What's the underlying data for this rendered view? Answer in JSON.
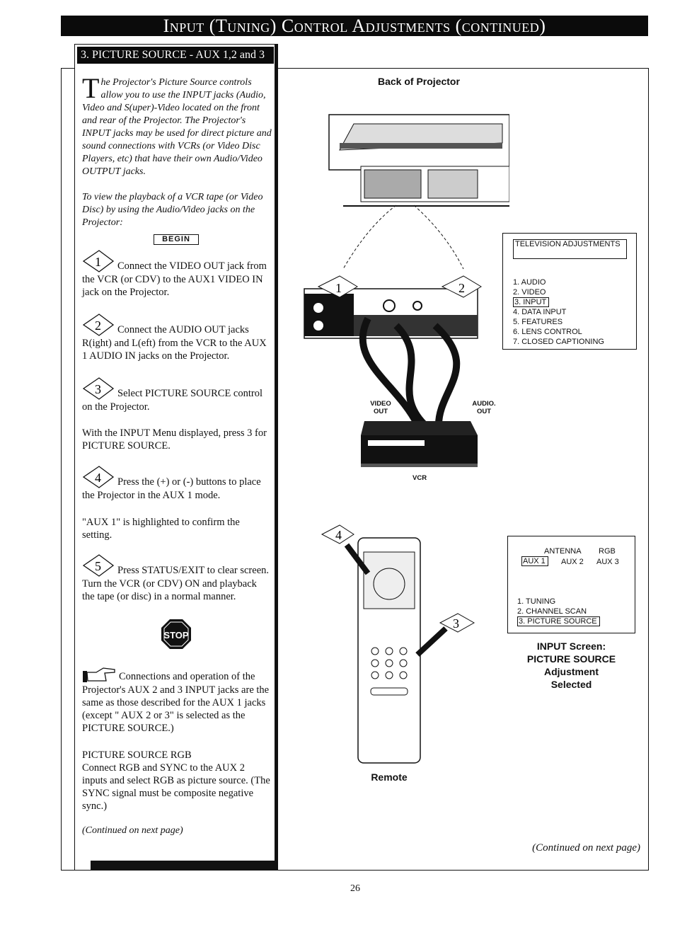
{
  "header": {
    "title": "Input (Tuning) Control Adjustments (continued)"
  },
  "section": {
    "title": "3. PICTURE SOURCE - AUX 1,2 and 3"
  },
  "intro": {
    "drop_cap": "T",
    "text": "he Projector's Picture Source controls allow you to use the INPUT jacks (Audio, Video and S(uper)-Video located on the front and rear of the Projector. The Projector's INPUT jacks may be used for direct picture and sound connections with VCRs (or Video Disc Players, etc) that have their own Audio/Video OUTPUT jacks.",
    "view": "To view the playback of a VCR tape (or Video Disc) by using the Audio/Video jacks on the Projector:"
  },
  "begin_label": "BEGIN",
  "steps": [
    {
      "num": "1",
      "text": "Connect the VIDEO OUT jack from the VCR (or CDV) to the AUX1 VIDEO IN jack on the Projector."
    },
    {
      "num": "2",
      "text": "Connect the AUDIO OUT jacks R(ight) and L(eft) from the VCR to the AUX 1 AUDIO IN jacks on the Projector."
    },
    {
      "num": "3",
      "text": "Select PICTURE SOURCE control on the Projector.",
      "extra": "With the INPUT Menu displayed, press 3 for PICTURE SOURCE."
    },
    {
      "num": "4",
      "text": "Press the (+) or (-) buttons to place the Projector in the AUX 1 mode.",
      "extra": "\"AUX 1\" is highlighted to confirm the setting."
    },
    {
      "num": "5",
      "text": "Press STATUS/EXIT to clear screen. Turn the VCR (or CDV) ON and playback the tape (or disc) in a normal manner."
    }
  ],
  "stop_label": "STOP",
  "note": {
    "icon": "pointing-hand-icon",
    "text": "Connections and operation of the Projector's AUX 2 and 3 INPUT jacks are the same as those described for the AUX 1 jacks (except \" AUX 2 or 3\" is selected as the PICTURE SOURCE.)"
  },
  "rgb": {
    "title": "PICTURE SOURCE RGB",
    "text": "Connect RGB and SYNC to the AUX 2 inputs and select RGB as picture source. (The SYNC signal must be composite negative sync.)"
  },
  "continued_left": "(Continued on next page)",
  "continued_right": "(Continued on next page)",
  "diagram": {
    "back_title": "Back of Projector",
    "video_out": "VIDEO OUT",
    "audio_out": "AUDIO. OUT",
    "vcr": "VCR",
    "remote": "Remote",
    "callouts": [
      "1",
      "2",
      "3",
      "4"
    ]
  },
  "tv_menu": {
    "title": "TELEVISION ADJUSTMENTS",
    "items": [
      "1. AUDIO",
      "2. VIDEO",
      "3. INPUT",
      "4. DATA INPUT",
      "5. FEATURES",
      "6. LENS CONTROL",
      "7. CLOSED CAPTIONING"
    ],
    "selected": "3. INPUT"
  },
  "input_menu": {
    "top": [
      "ANTENNA",
      "RGB"
    ],
    "sources": [
      "AUX 1",
      "AUX 2",
      "AUX 3"
    ],
    "selected_source": "AUX 1",
    "items": [
      "1. TUNING",
      "2. CHANNEL SCAN",
      "3. PICTURE SOURCE"
    ],
    "selected": "3. PICTURE SOURCE"
  },
  "input_caption": [
    "INPUT Screen:",
    "PICTURE SOURCE",
    "Adjustment",
    "Selected"
  ],
  "page_number": "26"
}
